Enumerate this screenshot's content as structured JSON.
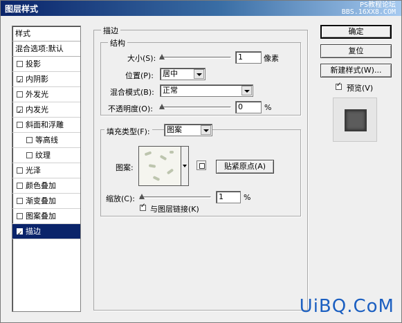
{
  "window": {
    "title": "图层样式",
    "watermark_lines": [
      "PS教程论坛",
      "BBS.16XX8.COM"
    ]
  },
  "style_list": {
    "header": "样式",
    "blend_options": "混合选项:默认",
    "items": [
      {
        "label": "投影",
        "checked": false,
        "sub": false,
        "selected": false
      },
      {
        "label": "内阴影",
        "checked": true,
        "sub": false,
        "selected": false
      },
      {
        "label": "外发光",
        "checked": false,
        "sub": false,
        "selected": false
      },
      {
        "label": "内发光",
        "checked": true,
        "sub": false,
        "selected": false
      },
      {
        "label": "斜面和浮雕",
        "checked": false,
        "sub": false,
        "selected": false
      },
      {
        "label": "等高线",
        "checked": false,
        "sub": true,
        "selected": false
      },
      {
        "label": "纹理",
        "checked": false,
        "sub": true,
        "selected": false
      },
      {
        "label": "光泽",
        "checked": false,
        "sub": false,
        "selected": false
      },
      {
        "label": "颜色叠加",
        "checked": false,
        "sub": false,
        "selected": false
      },
      {
        "label": "渐变叠加",
        "checked": false,
        "sub": false,
        "selected": false
      },
      {
        "label": "图案叠加",
        "checked": false,
        "sub": false,
        "selected": false
      },
      {
        "label": "描边",
        "checked": true,
        "sub": false,
        "selected": true
      }
    ]
  },
  "stroke": {
    "group_title": "描边",
    "structure_title": "结构",
    "size_label": "大小(S):",
    "size_value": "1",
    "size_unit": "像素",
    "size_level": 0,
    "position_label": "位置(P):",
    "position_value": "居中",
    "blend_label": "混合模式(B):",
    "blend_value": "正常",
    "opacity_label": "不透明度(O):",
    "opacity_value": "0",
    "opacity_unit": "%",
    "opacity_level": 0,
    "fill_type_label": "填充类型(F):",
    "fill_type_value": "图案",
    "pattern_label": "图案:",
    "snap_origin_label": "贴紧原点(A)",
    "scale_label": "缩放(C):",
    "scale_value": "1",
    "scale_unit": "%",
    "scale_level": 0,
    "link_layer_label": "与图层链接(K)",
    "link_layer_checked": true
  },
  "buttons": {
    "ok": "确定",
    "reset": "复位",
    "new_style": "新建样式(W)...",
    "preview_label": "预览(V)",
    "preview_checked": true
  },
  "site_watermark": "UiBQ.CoM"
}
